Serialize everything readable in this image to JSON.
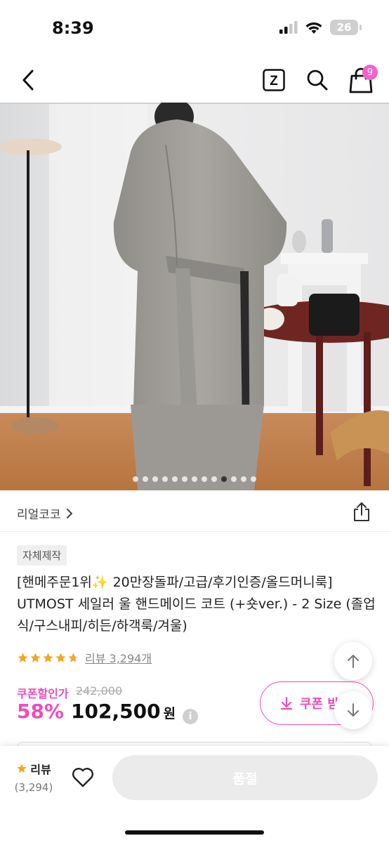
{
  "status_bar": {
    "time": "8:39",
    "battery": "26",
    "icons": [
      "signal-icon",
      "wifi-icon",
      "battery-icon"
    ]
  },
  "nav": {
    "back_icon": "chevron-left-icon",
    "z_logo": "Z",
    "search_icon": "search-icon",
    "cart_icon": "shopping-bag-icon",
    "cart_count": "9"
  },
  "gallery": {
    "total_pages": 13,
    "current_page": 10
  },
  "store": {
    "name": "리얼코코",
    "chevron": "›",
    "share_icon": "share-icon"
  },
  "product": {
    "badge": "자체제작",
    "title": "[핸메주문1위✨ 20만장돌파/고급/후기인증/올드머니룩] UTMOST 세일러 울 핸드메이드 코트 (+숏ver.) - 2 Size (졸업식/구스내피/히든/하객룩/겨울)",
    "rating": 4.7,
    "review_text": "리뷰 3,294개",
    "coupon_label": "쿠폰할인가",
    "original_price": "242,000",
    "discount": "58%",
    "price": "102,500",
    "currency": "원",
    "info_icon": "i"
  },
  "coupon_button": {
    "label": "쿠폰 받",
    "icon": "download-icon"
  },
  "floating": {
    "up_icon": "arrow-up-icon",
    "down_icon": "arrow-down-icon"
  },
  "bottom_bar": {
    "review_label": "리뷰",
    "review_count": "(3,294)",
    "heart_icon": "heart-icon",
    "buy_button": "품절"
  },
  "colors": {
    "accent": "#f04bbc",
    "badge_pink": "#f561c9",
    "star": "#f5a623",
    "disabled": "#ebebeb"
  }
}
